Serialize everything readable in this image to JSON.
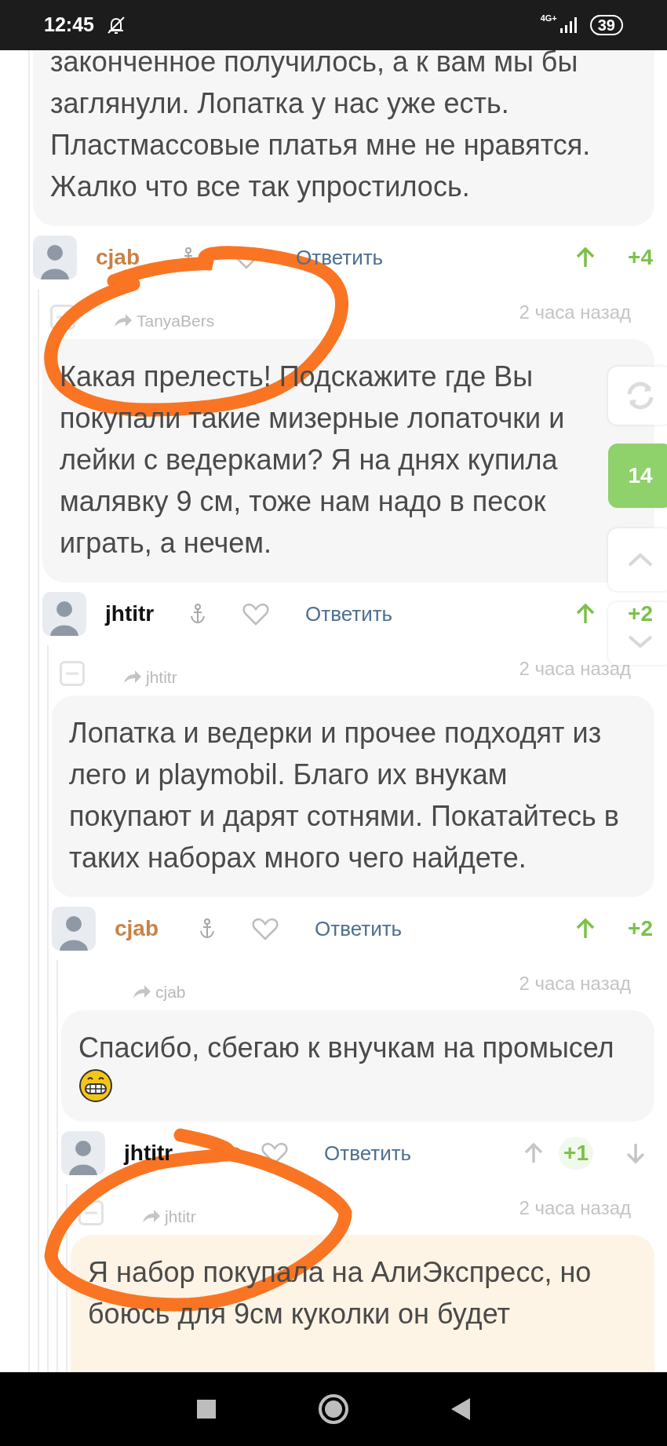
{
  "status_bar": {
    "time": "12:45",
    "network": "4G+",
    "battery": "39"
  },
  "thread": {
    "highlighted": false,
    "text": "законченное получилось, а к вам мы бы заглянули. Лопатка у нас уже есть. Пластмассовые платья мне не нравятся. Жалко что все так упростилось.",
    "kind": "text",
    "author": "cjab",
    "color": "#c98146",
    "reply_label": "Ответить",
    "rating": "+4",
    "upvoted": true,
    "children": [
      {
        "reply_to": "TanyaBers",
        "time": "2 часа назад",
        "collapsible": true,
        "highlighted": false,
        "kind": "text",
        "text": "Какая прелесть! Подскажите где Вы покупали такие мизерные лопаточки и лейки с ведерками? Я на днях купила малявку 9 см, тоже нам надо в песок играть, а нечем.",
        "author": "jhtitr",
        "color": "#111111",
        "reply_label": "Ответить",
        "rating": "+2",
        "upvoted": true,
        "children": [
          {
            "reply_to": "jhtitr",
            "time": "2 часа назад",
            "collapsible": true,
            "highlighted": false,
            "kind": "text",
            "text": "Лопатка и ведерки и прочее подходят из лего и playmobil. Благо их внукам покупают и дарят сотнями. Покатайтесь в таких наборах много чего найдете.",
            "author": "cjab",
            "color": "#c98146",
            "reply_label": "Ответить",
            "rating": "+2",
            "upvoted": true,
            "children": [
              {
                "reply_to": "cjab",
                "time": "2 часа назад",
                "collapsible": false,
                "highlighted": false,
                "kind": "text_with_grin",
                "text": "Спасибо, сбегаю к внучкам на промысел",
                "author": "jhtitr",
                "color": "#111111",
                "reply_label": "Ответить",
                "rating": "+1",
                "upvoted": false,
                "children": [
                  {
                    "reply_to": "jhtitr",
                    "time": "2 часа назад",
                    "collapsible": true,
                    "highlighted": true,
                    "kind": "text",
                    "text": "Я набор покупала на АлиЭкспресс, но боюсь для 9см куколки он будет"
                  }
                ]
              }
            ]
          }
        ]
      }
    ]
  },
  "side_panel": {
    "count": "14"
  }
}
